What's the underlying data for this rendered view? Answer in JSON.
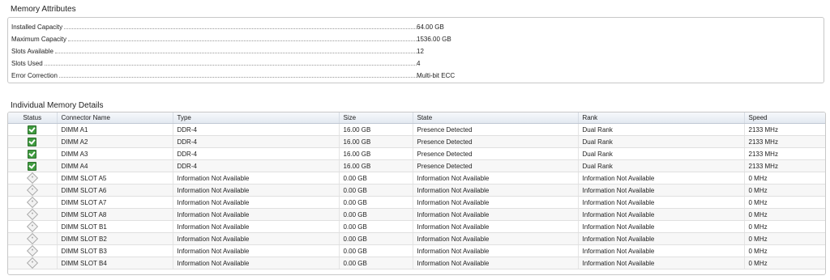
{
  "memory_attributes": {
    "title": "Memory Attributes",
    "rows": [
      {
        "label": "Installed Capacity",
        "value": "64.00 GB"
      },
      {
        "label": "Maximum Capacity",
        "value": "1536.00 GB"
      },
      {
        "label": "Slots Available",
        "value": "12"
      },
      {
        "label": "Slots Used",
        "value": "4"
      },
      {
        "label": "Error Correction",
        "value": "Multi-bit ECC"
      }
    ]
  },
  "details": {
    "title": "Individual Memory Details",
    "columns": [
      "Status",
      "Connector Name",
      "Type",
      "Size",
      "State",
      "Rank",
      "Speed"
    ],
    "rows": [
      {
        "status": "ok-icon",
        "connector": "DIMM A1",
        "type": "DDR-4",
        "size": "16.00 GB",
        "state": "Presence Detected",
        "rank": "Dual Rank",
        "speed": "2133 MHz"
      },
      {
        "status": "ok-icon",
        "connector": "DIMM A2",
        "type": "DDR-4",
        "size": "16.00 GB",
        "state": "Presence Detected",
        "rank": "Dual Rank",
        "speed": "2133 MHz"
      },
      {
        "status": "ok-icon",
        "connector": "DIMM A3",
        "type": "DDR-4",
        "size": "16.00 GB",
        "state": "Presence Detected",
        "rank": "Dual Rank",
        "speed": "2133 MHz"
      },
      {
        "status": "ok-icon",
        "connector": "DIMM A4",
        "type": "DDR-4",
        "size": "16.00 GB",
        "state": "Presence Detected",
        "rank": "Dual Rank",
        "speed": "2133 MHz"
      },
      {
        "status": "unknown-icon",
        "connector": "DIMM SLOT A5",
        "type": "Information Not Available",
        "size": "0.00 GB",
        "state": "Information Not Available",
        "rank": "Information Not Available",
        "speed": "0 MHz"
      },
      {
        "status": "unknown-icon",
        "connector": "DIMM SLOT A6",
        "type": "Information Not Available",
        "size": "0.00 GB",
        "state": "Information Not Available",
        "rank": "Information Not Available",
        "speed": "0 MHz"
      },
      {
        "status": "unknown-icon",
        "connector": "DIMM SLOT A7",
        "type": "Information Not Available",
        "size": "0.00 GB",
        "state": "Information Not Available",
        "rank": "Information Not Available",
        "speed": "0 MHz"
      },
      {
        "status": "unknown-icon",
        "connector": "DIMM SLOT A8",
        "type": "Information Not Available",
        "size": "0.00 GB",
        "state": "Information Not Available",
        "rank": "Information Not Available",
        "speed": "0 MHz"
      },
      {
        "status": "unknown-icon",
        "connector": "DIMM SLOT B1",
        "type": "Information Not Available",
        "size": "0.00 GB",
        "state": "Information Not Available",
        "rank": "Information Not Available",
        "speed": "0 MHz"
      },
      {
        "status": "unknown-icon",
        "connector": "DIMM SLOT B2",
        "type": "Information Not Available",
        "size": "0.00 GB",
        "state": "Information Not Available",
        "rank": "Information Not Available",
        "speed": "0 MHz"
      },
      {
        "status": "unknown-icon",
        "connector": "DIMM SLOT B3",
        "type": "Information Not Available",
        "size": "0.00 GB",
        "state": "Information Not Available",
        "rank": "Information Not Available",
        "speed": "0 MHz"
      },
      {
        "status": "unknown-icon",
        "connector": "DIMM SLOT B4",
        "type": "Information Not Available",
        "size": "0.00 GB",
        "state": "Information Not Available",
        "rank": "Information Not Available",
        "speed": "0 MHz"
      }
    ]
  },
  "colors": {
    "ok": "#3f9b3f",
    "header_bg": "#e3e9f1"
  }
}
